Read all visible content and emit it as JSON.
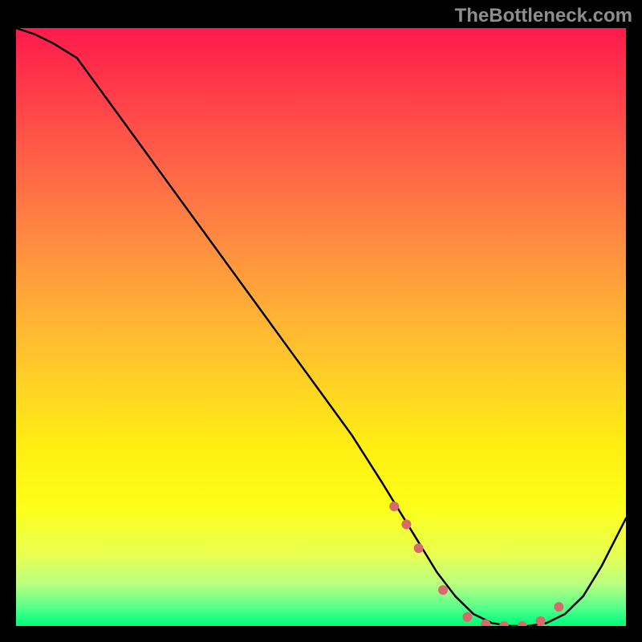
{
  "watermark": "TheBottleneck.com",
  "chart_data": {
    "type": "line",
    "title": "",
    "xlabel": "",
    "ylabel": "",
    "xlim": [
      0,
      100
    ],
    "ylim": [
      0,
      100
    ],
    "series": [
      {
        "name": "curve",
        "x": [
          0,
          3,
          6,
          10,
          15,
          20,
          25,
          30,
          35,
          40,
          45,
          50,
          55,
          60,
          63,
          66,
          69,
          72,
          75,
          78,
          81,
          84,
          87,
          90,
          93,
          96,
          100
        ],
        "values": [
          100,
          99,
          97.5,
          95,
          88,
          81,
          74,
          67,
          60,
          53,
          46,
          39,
          32,
          24,
          19,
          14,
          9,
          5,
          2,
          0.5,
          0,
          0,
          0.5,
          2,
          5,
          10,
          18
        ]
      }
    ],
    "markers": {
      "name": "highlight-dots",
      "color": "#d86a6a",
      "x": [
        62,
        64,
        66,
        70,
        74,
        77,
        80,
        83,
        86,
        89
      ],
      "values": [
        20,
        17,
        13,
        6,
        1.5,
        0.3,
        0,
        0,
        0.8,
        3.2
      ]
    },
    "colors": {
      "curve": "#000000",
      "gradient_top": "#ff1a4b",
      "gradient_bottom": "#00ff74",
      "background": "#000000"
    }
  }
}
